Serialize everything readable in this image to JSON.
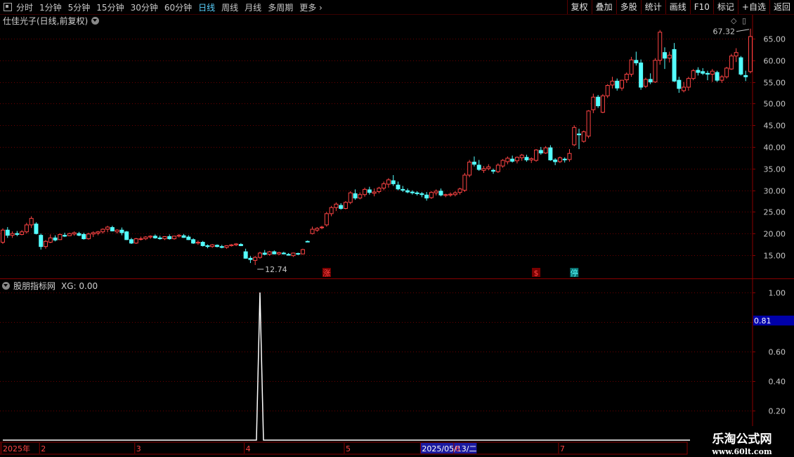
{
  "toolbar": {
    "periods": [
      "分时",
      "1分钟",
      "5分钟",
      "15分钟",
      "30分钟",
      "60分钟",
      "日线",
      "周线",
      "月线",
      "多周期",
      "更多"
    ],
    "active_period": "日线",
    "buttons": [
      "复权",
      "叠加",
      "多股",
      "统计",
      "画线",
      "F10",
      "标记",
      "+自选",
      "返回"
    ]
  },
  "stock": {
    "title": "仕佳光子(日线,前复权)"
  },
  "indicator": {
    "name": "股朋指标网",
    "xg_label": "XG: 0.00",
    "current_value": "0.81"
  },
  "colors": {
    "up": "#ff4444",
    "down": "#54ffff",
    "grid": "#6a0000",
    "axis": "#c8c8c8",
    "xg_line": "#ffffff",
    "cursor_box": "#0000aa"
  },
  "chart_data": [
    {
      "type": "candlestick",
      "ylim": [
        10,
        68
      ],
      "y_ticks": [
        "15.00",
        "20.00",
        "25.00",
        "30.00",
        "35.00",
        "40.00",
        "45.00",
        "50.00",
        "55.00",
        "60.00",
        "65.00"
      ],
      "grid": true,
      "annotations": {
        "high_label": "67.32",
        "low_label": "12.74"
      },
      "markers": [
        {
          "label": "涨",
          "index": 68,
          "color": "#ff4444"
        },
        {
          "label": "$",
          "index": 112,
          "color": "#ff4444"
        },
        {
          "label": "停",
          "index": 120,
          "color": "#54ffff"
        }
      ],
      "ohlc": [
        [
          18.0,
          21.2,
          17.6,
          20.8
        ],
        [
          20.8,
          21.5,
          19.0,
          19.6
        ],
        [
          19.6,
          20.5,
          19.0,
          20.0
        ],
        [
          20.0,
          20.6,
          19.4,
          19.8
        ],
        [
          19.8,
          20.8,
          19.6,
          20.4
        ],
        [
          20.4,
          22.5,
          20.0,
          22.0
        ],
        [
          22.0,
          24.0,
          21.3,
          23.5
        ],
        [
          22.2,
          22.6,
          19.8,
          20.0
        ],
        [
          19.6,
          20.0,
          16.3,
          17.0
        ],
        [
          17.0,
          18.5,
          16.5,
          18.2
        ],
        [
          18.0,
          19.8,
          17.8,
          19.0
        ],
        [
          19.0,
          19.6,
          18.2,
          18.5
        ],
        [
          18.6,
          20.0,
          18.5,
          19.8
        ],
        [
          19.6,
          20.2,
          19.2,
          19.4
        ],
        [
          19.5,
          20.2,
          19.4,
          20.0
        ],
        [
          19.9,
          20.5,
          19.5,
          20.2
        ],
        [
          20.0,
          20.4,
          19.4,
          19.6
        ],
        [
          19.8,
          20.2,
          18.6,
          18.8
        ],
        [
          18.8,
          20.2,
          18.6,
          19.9
        ],
        [
          19.9,
          20.5,
          19.2,
          20.2
        ],
        [
          20.1,
          20.6,
          19.6,
          20.4
        ],
        [
          20.4,
          21.2,
          20.0,
          21.0
        ],
        [
          21.0,
          21.8,
          20.3,
          21.5
        ],
        [
          21.4,
          21.8,
          20.5,
          20.6
        ],
        [
          20.4,
          21.0,
          20.0,
          20.8
        ],
        [
          20.8,
          21.4,
          19.6,
          20.2
        ],
        [
          20.4,
          20.6,
          18.5,
          18.6
        ],
        [
          18.6,
          19.0,
          17.6,
          17.8
        ],
        [
          17.8,
          19.0,
          17.6,
          18.8
        ],
        [
          18.7,
          19.3,
          18.4,
          18.8
        ],
        [
          18.8,
          19.4,
          18.5,
          19.2
        ],
        [
          19.2,
          19.6,
          18.8,
          19.4
        ],
        [
          19.4,
          19.8,
          18.8,
          19.0
        ],
        [
          19.0,
          19.5,
          18.6,
          18.8
        ],
        [
          18.8,
          19.4,
          18.5,
          19.3
        ],
        [
          19.3,
          19.8,
          18.6,
          18.8
        ],
        [
          18.8,
          19.5,
          18.6,
          19.4
        ],
        [
          19.4,
          19.9,
          19.1,
          19.6
        ],
        [
          19.5,
          19.9,
          19.0,
          19.1
        ],
        [
          19.2,
          19.6,
          18.5,
          18.6
        ],
        [
          18.6,
          18.9,
          17.6,
          17.8
        ],
        [
          17.8,
          18.4,
          17.4,
          18.0
        ],
        [
          18.0,
          18.3,
          17.0,
          17.2
        ],
        [
          17.2,
          17.5,
          16.6,
          17.0
        ],
        [
          17.0,
          17.6,
          16.7,
          17.4
        ],
        [
          17.3,
          17.5,
          16.8,
          17.0
        ],
        [
          17.0,
          17.4,
          16.6,
          16.8
        ],
        [
          16.8,
          17.3,
          16.5,
          17.2
        ],
        [
          17.2,
          17.6,
          17.0,
          17.4
        ],
        [
          17.4,
          17.8,
          17.1,
          17.6
        ],
        [
          17.5,
          17.8,
          17.1,
          17.2
        ],
        [
          15.8,
          16.5,
          14.2,
          14.3
        ],
        [
          14.3,
          14.8,
          13.2,
          14.0
        ],
        [
          13.8,
          14.8,
          12.74,
          14.5
        ],
        [
          14.5,
          15.8,
          14.2,
          15.5
        ],
        [
          15.5,
          16.2,
          15.0,
          15.2
        ],
        [
          15.2,
          16.0,
          14.9,
          15.8
        ],
        [
          15.8,
          16.1,
          15.2,
          15.3
        ],
        [
          15.3,
          15.8,
          15.0,
          15.6
        ],
        [
          15.5,
          15.8,
          15.2,
          15.3
        ],
        [
          15.2,
          15.5,
          14.9,
          15.0
        ],
        [
          14.9,
          15.6,
          14.6,
          15.5
        ],
        [
          15.4,
          15.6,
          15.0,
          15.3
        ],
        [
          15.3,
          16.5,
          15.2,
          16.3
        ],
        [
          18.2,
          18.4,
          18.0,
          18.1
        ],
        [
          20.0,
          21.6,
          19.8,
          21.0
        ],
        [
          20.8,
          21.5,
          20.4,
          21.2
        ],
        [
          21.4,
          21.8,
          21.0,
          21.5
        ],
        [
          22.0,
          25.0,
          21.6,
          24.6
        ],
        [
          24.6,
          26.4,
          24.0,
          26.0
        ],
        [
          26.0,
          27.2,
          25.2,
          26.8
        ],
        [
          26.5,
          27.0,
          25.5,
          25.8
        ],
        [
          25.8,
          27.5,
          25.6,
          27.2
        ],
        [
          27.2,
          29.8,
          26.8,
          29.4
        ],
        [
          29.2,
          30.2,
          27.8,
          28.2
        ],
        [
          28.2,
          29.5,
          27.9,
          29.0
        ],
        [
          29.0,
          30.6,
          28.5,
          30.2
        ],
        [
          30.1,
          30.8,
          29.0,
          29.5
        ],
        [
          29.3,
          30.4,
          28.6,
          29.6
        ],
        [
          29.7,
          30.8,
          29.3,
          30.5
        ],
        [
          30.5,
          32.0,
          30.0,
          31.5
        ],
        [
          31.4,
          32.8,
          30.6,
          32.4
        ],
        [
          32.2,
          33.5,
          31.0,
          31.5
        ],
        [
          31.2,
          32.0,
          30.0,
          30.3
        ],
        [
          30.2,
          31.0,
          29.6,
          30.0
        ],
        [
          29.9,
          30.4,
          29.3,
          29.6
        ],
        [
          29.6,
          30.0,
          29.0,
          29.4
        ],
        [
          29.4,
          29.8,
          28.8,
          29.2
        ],
        [
          29.2,
          29.6,
          28.4,
          29.0
        ],
        [
          28.9,
          29.6,
          27.6,
          28.2
        ],
        [
          28.3,
          29.8,
          28.0,
          29.5
        ],
        [
          29.4,
          30.2,
          28.8,
          29.8
        ],
        [
          29.8,
          30.4,
          28.6,
          28.9
        ],
        [
          28.8,
          29.2,
          28.4,
          29.0
        ],
        [
          28.9,
          29.5,
          28.5,
          29.1
        ],
        [
          29.0,
          29.8,
          28.6,
          29.4
        ],
        [
          29.5,
          30.6,
          29.0,
          30.3
        ],
        [
          30.0,
          34.0,
          29.6,
          33.5
        ],
        [
          33.5,
          37.0,
          33.0,
          36.5
        ],
        [
          36.5,
          37.8,
          35.5,
          36.0
        ],
        [
          35.8,
          37.0,
          34.5,
          34.8
        ],
        [
          34.6,
          35.6,
          34.0,
          35.0
        ],
        [
          35.0,
          36.0,
          34.6,
          35.4
        ],
        [
          34.6,
          35.0,
          33.8,
          34.4
        ],
        [
          34.3,
          36.2,
          34.0,
          35.8
        ],
        [
          35.6,
          37.2,
          35.2,
          36.9
        ],
        [
          36.6,
          37.8,
          36.0,
          37.4
        ],
        [
          37.2,
          38.0,
          36.4,
          36.7
        ],
        [
          36.8,
          37.8,
          36.2,
          37.6
        ],
        [
          37.5,
          38.4,
          36.8,
          38.1
        ],
        [
          37.6,
          38.2,
          36.6,
          37.0
        ],
        [
          37.0,
          37.6,
          36.3,
          37.3
        ],
        [
          36.9,
          39.5,
          36.6,
          39.3
        ],
        [
          39.2,
          40.0,
          38.2,
          38.6
        ],
        [
          38.6,
          40.2,
          38.4,
          39.8
        ],
        [
          39.8,
          40.4,
          36.8,
          37.0
        ],
        [
          37.0,
          37.4,
          35.8,
          36.6
        ],
        [
          36.6,
          37.8,
          36.3,
          37.5
        ],
        [
          37.2,
          37.6,
          36.4,
          37.0
        ],
        [
          37.1,
          39.5,
          36.6,
          38.5
        ],
        [
          40.5,
          45.0,
          40.2,
          44.5
        ],
        [
          43.0,
          44.2,
          39.5,
          42.8
        ],
        [
          41.3,
          43.8,
          41.0,
          43.5
        ],
        [
          42.5,
          48.5,
          42.0,
          48.3
        ],
        [
          48.6,
          52.3,
          47.8,
          51.5
        ],
        [
          51.5,
          52.0,
          49.0,
          49.5
        ],
        [
          48.0,
          52.2,
          47.8,
          51.8
        ],
        [
          51.8,
          54.5,
          51.3,
          54.2
        ],
        [
          54.3,
          56.2,
          53.5,
          55.2
        ],
        [
          55.2,
          55.8,
          53.0,
          53.6
        ],
        [
          53.6,
          55.5,
          53.0,
          55.4
        ],
        [
          55.5,
          57.2,
          54.8,
          56.8
        ],
        [
          56.8,
          60.8,
          56.2,
          60.1
        ],
        [
          60.0,
          62.0,
          58.8,
          59.4
        ],
        [
          59.4,
          60.2,
          53.2,
          53.8
        ],
        [
          54.0,
          56.0,
          53.6,
          55.6
        ],
        [
          55.6,
          57.0,
          54.5,
          55.0
        ],
        [
          55.0,
          60.5,
          54.8,
          60.0
        ],
        [
          60.0,
          67.0,
          59.0,
          66.5
        ],
        [
          61.8,
          63.0,
          58.0,
          60.5
        ],
        [
          60.5,
          62.0,
          59.5,
          61.2
        ],
        [
          62.5,
          64.0,
          55.0,
          55.2
        ],
        [
          55.4,
          56.2,
          52.5,
          53.5
        ],
        [
          53.0,
          55.0,
          52.6,
          53.8
        ],
        [
          53.8,
          56.2,
          53.0,
          55.8
        ],
        [
          55.8,
          58.0,
          55.4,
          57.6
        ],
        [
          57.7,
          58.4,
          56.5,
          57.2
        ],
        [
          57.4,
          58.2,
          56.6,
          57.0
        ],
        [
          57.0,
          57.6,
          55.4,
          56.8
        ],
        [
          56.8,
          58.0,
          55.0,
          57.5
        ],
        [
          57.2,
          57.6,
          55.0,
          55.4
        ],
        [
          55.4,
          56.6,
          54.8,
          56.2
        ],
        [
          56.2,
          58.5,
          55.8,
          58.2
        ],
        [
          58.0,
          61.5,
          57.8,
          61.0
        ],
        [
          61.0,
          62.8,
          59.6,
          61.8
        ],
        [
          60.6,
          61.0,
          56.5,
          56.8
        ],
        [
          56.5,
          57.6,
          55.2,
          56.2
        ],
        [
          57.4,
          67.32,
          57.0,
          65.5
        ]
      ]
    },
    {
      "type": "line",
      "series": [
        {
          "name": "XG",
          "spike_index": 54,
          "spike_value": 1.0,
          "baseline_value": 0.0
        }
      ],
      "ylim": [
        0,
        1.05
      ],
      "y_ticks": [
        "0.20",
        "0.40",
        "0.60",
        "0.80",
        "1.00"
      ],
      "x_labels": [
        "2025年",
        "2",
        "3",
        "4",
        "5",
        "2025/05/13/二",
        "6",
        "7"
      ],
      "x_label_index": [
        0,
        8,
        28,
        51,
        72,
        88,
        95,
        117
      ],
      "grid": true
    }
  ]
}
